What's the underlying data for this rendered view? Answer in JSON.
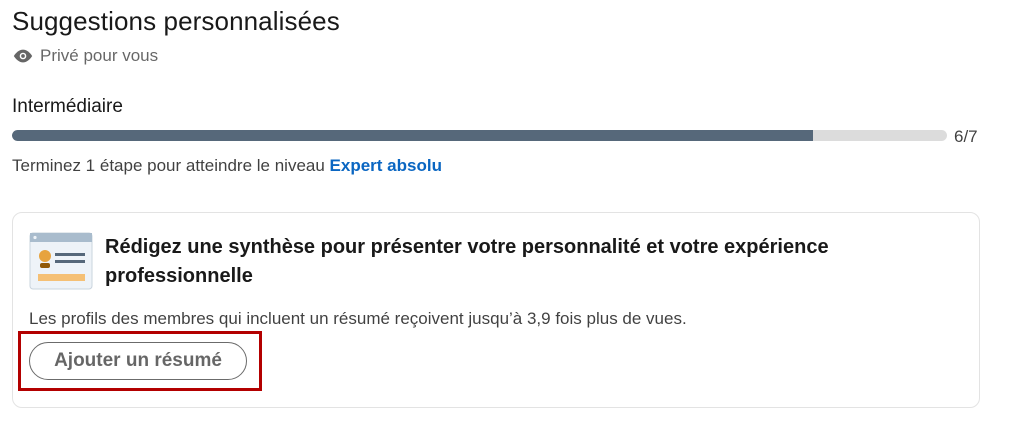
{
  "section": {
    "title": "Suggestions personnalisées",
    "privacy_text": "Privé pour vous",
    "privacy_icon": "eye-icon"
  },
  "level": {
    "label": "Intermédiaire",
    "progress_current": 6,
    "progress_total": 7,
    "progress_text": "6/7",
    "next_prefix": "Terminez 1 étape pour atteindre le niveau",
    "next_level_link": "Expert absolu"
  },
  "suggestion_card": {
    "icon": "profile-card-illustration-icon",
    "heading": "Rédigez une synthèse pour présenter votre personnalité et votre expérience professionnelle",
    "description": "Les profils des membres qui incluent un résumé reçoivent jusqu’à 3,9 fois plus de vues.",
    "button_label": "Ajouter un résumé"
  },
  "colors": {
    "progress_fill": "#56687a",
    "progress_track": "#dcdcdc",
    "link": "#0a66c2",
    "highlight_border": "#b30000"
  }
}
